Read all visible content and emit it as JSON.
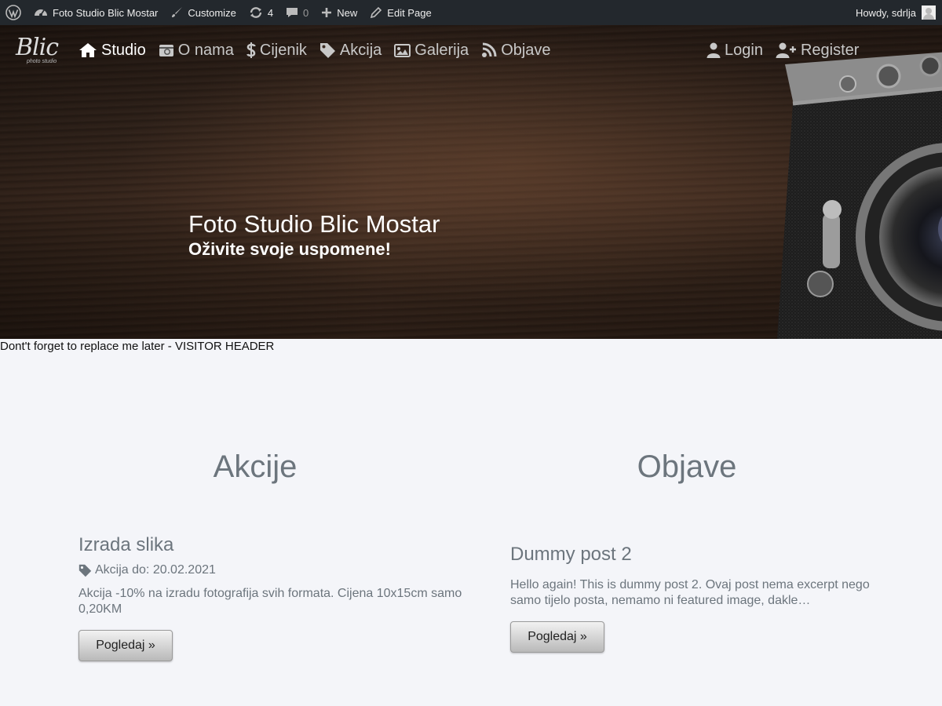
{
  "admin_bar": {
    "site_name": "Foto Studio Blic Mostar",
    "customize": "Customize",
    "updates_count": "4",
    "comments_count": "0",
    "new": "New",
    "edit_page": "Edit Page",
    "howdy": "Howdy, sdrlja"
  },
  "logo": {
    "text": "Blic",
    "subtitle": "photo studio"
  },
  "nav": {
    "items": [
      {
        "label": "Studio",
        "icon": "home-icon",
        "active": true
      },
      {
        "label": "O nama",
        "icon": "camera-icon"
      },
      {
        "label": "Cijenik",
        "icon": "dollar-icon"
      },
      {
        "label": "Akcija",
        "icon": "tag-icon"
      },
      {
        "label": "Galerija",
        "icon": "image-icon"
      },
      {
        "label": "Objave",
        "icon": "feed-icon"
      }
    ],
    "login": "Login",
    "register": "Register"
  },
  "hero": {
    "title": "Foto Studio Blic Mostar",
    "subtitle": "Oživite svoje uspomene!"
  },
  "visitor_note": "Dont't forget to replace me later - VISITOR HEADER",
  "akcije": {
    "heading": "Akcije",
    "post_title": "Izrada slika",
    "meta": "Akcija do: 20.02.2021",
    "text": "Akcija -10% na izradu fotografija svih formata. Cijena 10x15cm samo 0,20KM",
    "button": "Pogledaj »"
  },
  "objave": {
    "heading": "Objave",
    "post_title": "Dummy post 2",
    "text": "Hello again! This is dummy post 2. Ovaj post nema excerpt nego samo tijelo posta, nemamo ni featured image, dakle…",
    "button": "Pogledaj »"
  },
  "colors": {
    "admin_bar_bg": "#23282d",
    "page_bg": "#f4f5f9",
    "muted_text": "#6c757d"
  }
}
